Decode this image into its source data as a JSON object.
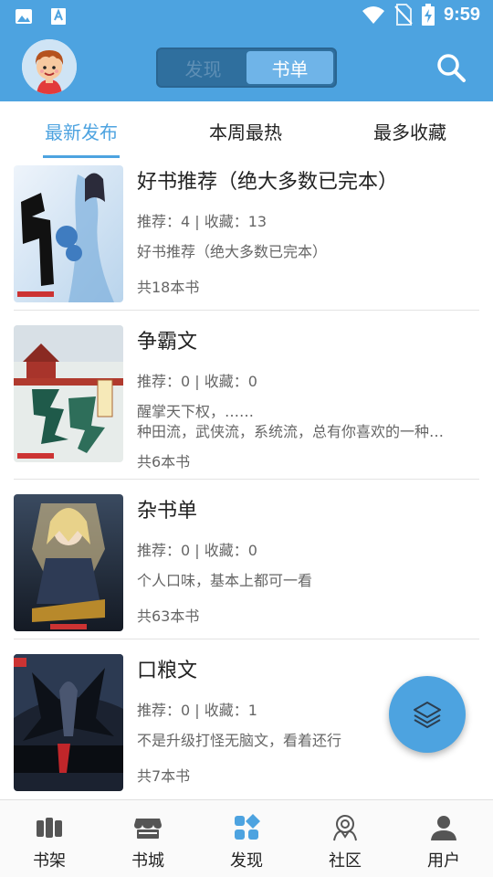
{
  "status_bar": {
    "time": "9:59"
  },
  "header": {
    "segments": [
      {
        "label": "发现",
        "active": false
      },
      {
        "label": "书单",
        "active": true
      }
    ]
  },
  "tabs": [
    {
      "label": "最新发布",
      "active": true
    },
    {
      "label": "本周最热",
      "active": false
    },
    {
      "label": "最多收藏",
      "active": false
    }
  ],
  "booklists": [
    {
      "title": "好书推荐（绝大多数已完本）",
      "stats": "推荐：4 | 收藏：13",
      "desc": [
        "好书推荐（绝大多数已完本）"
      ],
      "count": "共18本书"
    },
    {
      "title": "争霸文",
      "stats": "推荐：0 | 收藏：0",
      "desc": [
        "醒掌天下权，……",
        "种田流，武侠流，系统流，总有你喜欢的一种…"
      ],
      "count": "共6本书"
    },
    {
      "title": "杂书单",
      "stats": "推荐：0 | 收藏：0",
      "desc": [
        "个人口味，基本上都可一看"
      ],
      "count": "共63本书"
    },
    {
      "title": "口粮文",
      "stats": "推荐：0 | 收藏：1",
      "desc": [
        "不是升级打怪无脑文，看着还行"
      ],
      "count": "共7本书"
    }
  ],
  "bottom_nav": [
    {
      "label": "书架",
      "icon": "bookshelf-icon"
    },
    {
      "label": "书城",
      "icon": "store-icon"
    },
    {
      "label": "发现",
      "icon": "discover-icon",
      "active": true
    },
    {
      "label": "社区",
      "icon": "community-icon"
    },
    {
      "label": "用户",
      "icon": "user-icon"
    }
  ],
  "colors": {
    "primary": "#4da3e0",
    "dark_segment": "#2f6f9e"
  }
}
